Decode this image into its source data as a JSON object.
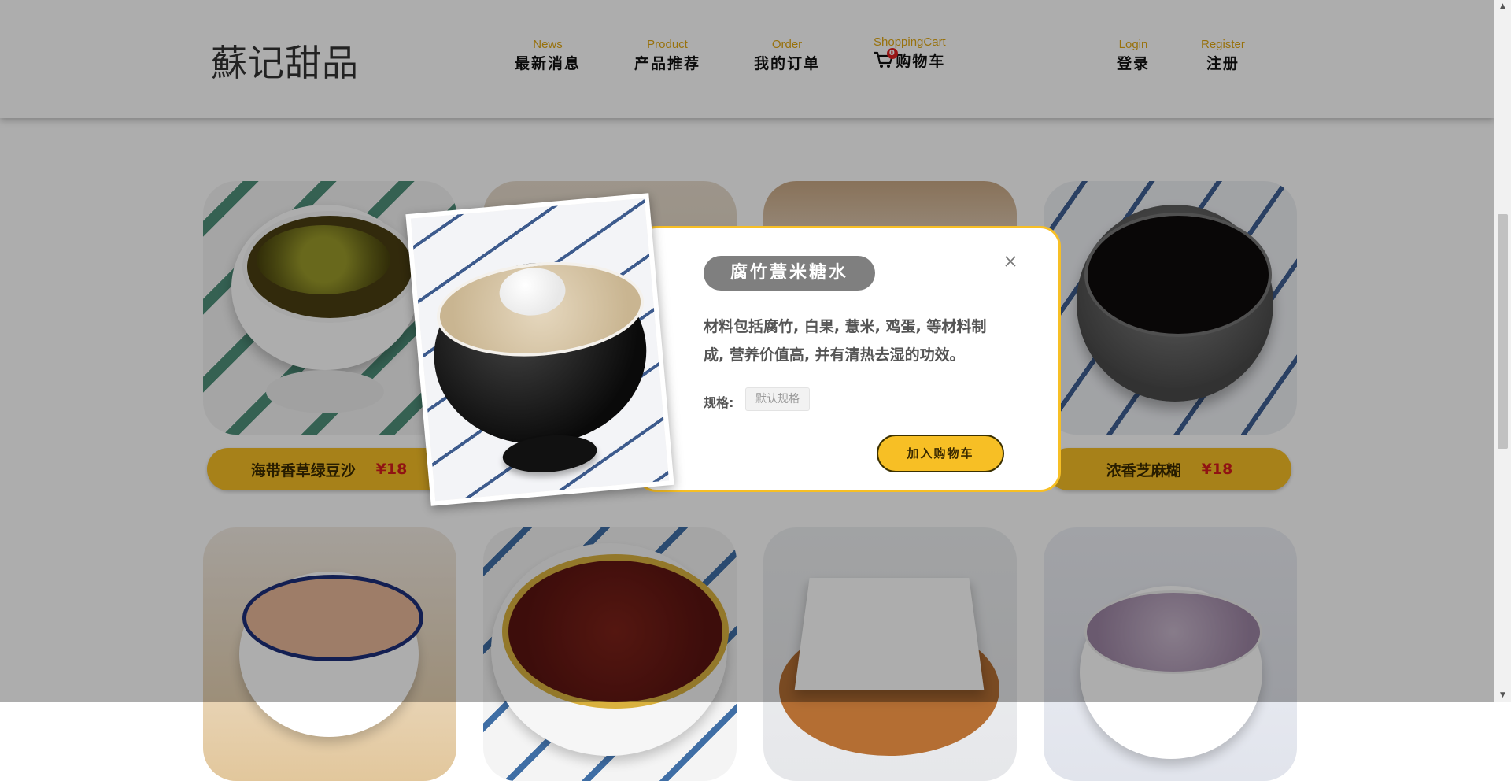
{
  "header": {
    "logo": "蘇记甜品",
    "nav": [
      {
        "en": "News",
        "cn": "最新消息"
      },
      {
        "en": "Product",
        "cn": "产品推荐"
      },
      {
        "en": "Order",
        "cn": "我的订单"
      },
      {
        "en": "ShoppingCart",
        "cn": "购物车",
        "badge": "0"
      },
      {
        "en": "Login",
        "cn": "登录"
      },
      {
        "en": "Register",
        "cn": "注册"
      }
    ]
  },
  "products": [
    {
      "name": "海带香草绿豆沙",
      "price": "¥18"
    },
    {
      "name": "浓香芝麻糊",
      "price": "¥18"
    }
  ],
  "modal": {
    "title": "腐竹薏米糖水",
    "description": "材料包括腐竹, 白果, 薏米, 鸡蛋, 等材料制成, 营养价值高, 并有清热去湿的功效。",
    "spec_label": "规格:",
    "spec_value": "默认规格",
    "add_button": "加入购物车"
  },
  "colors": {
    "accent": "#f7bf25",
    "price": "#d41d1d",
    "nav_en": "#e0a712"
  }
}
